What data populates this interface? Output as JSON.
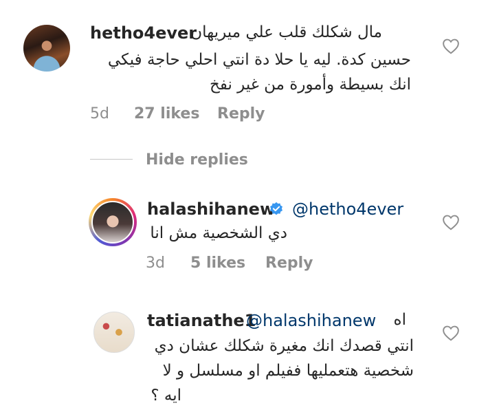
{
  "comments": [
    {
      "username": "hetho4ever",
      "first_line": "مال شكلك قلب علي ميريهان",
      "lines": [
        "حسين كدة. ليه يا حلا دة انتي احلي حاجة فيكي",
        "انك بسيطة وأمورة من غير نفخ"
      ],
      "time": "5d",
      "likes": "27 likes",
      "reply": "Reply"
    },
    {
      "username": "halashihanew",
      "mention": "@hetho4ever",
      "lines": [
        "دي الشخصية مش انا"
      ],
      "time": "3d",
      "likes": "5 likes",
      "reply": "Reply"
    },
    {
      "username": "tatianathe1",
      "mention": "@halashihanew",
      "first_line": "اه",
      "lines": [
        "انتي قصدك انك مغيرة شكلك عشان دي",
        "شخصية هتعمليها ففيلم او مسلسل و لا",
        "ايه ؟"
      ]
    }
  ],
  "hide_replies": "Hide replies",
  "colors": {
    "mention": "#00376b",
    "meta": "#8e8e8e",
    "verified": "#3897f0"
  }
}
